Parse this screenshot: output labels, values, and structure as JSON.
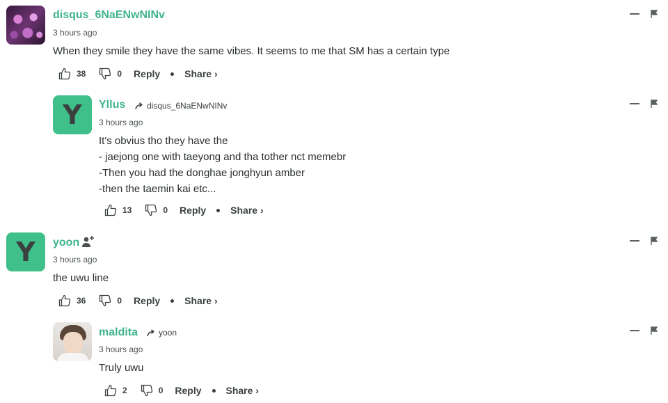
{
  "comments": [
    {
      "author": "disqus_6NaENwNINv",
      "timestamp": "3 hours ago",
      "lines": [
        "When they smile they have the same vibes. It seems to me that SM has a certain type"
      ],
      "upvotes": "38",
      "downvotes": "0",
      "reply_label": "Reply",
      "share_label": "Share ›"
    },
    {
      "author": "Yllus",
      "avatar_letter": "Y",
      "reply_to": "disqus_6NaENwNINv",
      "timestamp": "3 hours ago",
      "lines": [
        "It's obvius tho they have the",
        "- jaejong one with taeyong and tha tother nct memebr",
        "-Then you had the donghae jonghyun amber",
        "-then the taemin kai etc..."
      ],
      "upvotes": "13",
      "downvotes": "0",
      "reply_label": "Reply",
      "share_label": "Share ›"
    },
    {
      "author": "yoon",
      "avatar_letter": "Y",
      "timestamp": "3 hours ago",
      "lines": [
        "the uwu line"
      ],
      "upvotes": "36",
      "downvotes": "0",
      "reply_label": "Reply",
      "share_label": "Share ›"
    },
    {
      "author": "maldita",
      "reply_to": "yoon",
      "timestamp": "3 hours ago",
      "lines": [
        "Truly uwu"
      ],
      "upvotes": "2",
      "downvotes": "0",
      "reply_label": "Reply",
      "share_label": "Share ›"
    }
  ],
  "colors": {
    "accent": "#3fb48b",
    "avatar_bg": "#3fbf8a",
    "text": "#2a2e2e"
  },
  "icons": [
    "thumbs-up-icon",
    "thumbs-down-icon",
    "reply-arrow-icon",
    "add-user-icon",
    "minimize-icon",
    "flag-icon"
  ]
}
